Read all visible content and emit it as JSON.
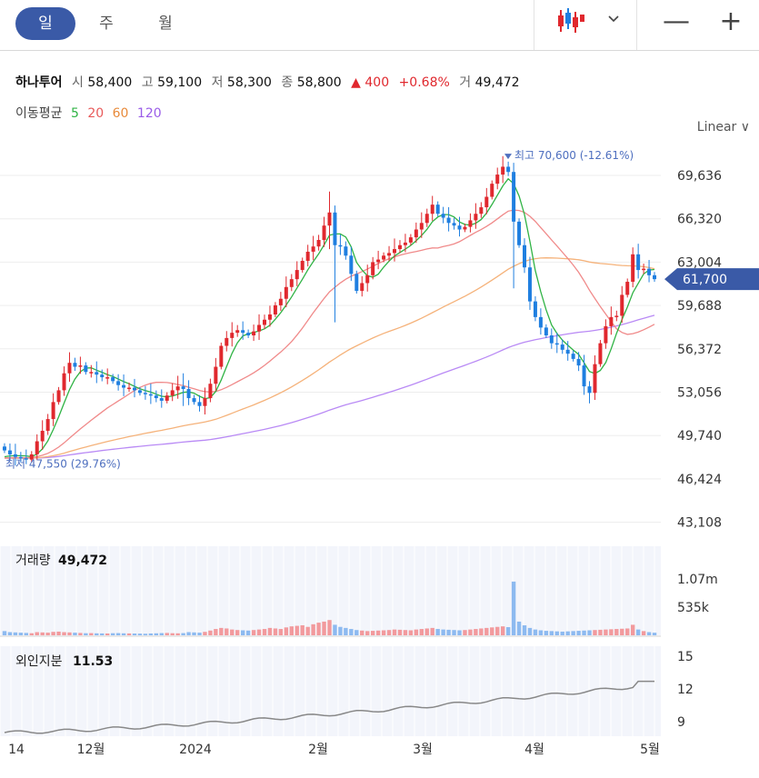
{
  "toolbar": {
    "periods": [
      "일",
      "주",
      "월"
    ],
    "active_period": "일",
    "chart_type_icon": "candlestick-icon",
    "dropdown_icon": "chevron-down-icon",
    "zoom_out": "—",
    "zoom_in": "+"
  },
  "quote": {
    "name": "하나투어",
    "open_label": "시",
    "open": "58,400",
    "high_label": "고",
    "high": "59,100",
    "low_label": "저",
    "low": "58,300",
    "close_label": "종",
    "close": "58,800",
    "change": "▲ 400",
    "change_pct": "+0.68%",
    "volume_label": "거",
    "volume": "49,472"
  },
  "ma_legend": {
    "label": "이동평균",
    "items": [
      {
        "name": "5",
        "color": "#2fb344"
      },
      {
        "name": "20",
        "color": "#f08a8a"
      },
      {
        "name": "60",
        "color": "#f2a25e"
      },
      {
        "name": "120",
        "color": "#a66cf0"
      }
    ]
  },
  "scale_mode": "Linear ∨",
  "chart_data": {
    "type": "candlestick",
    "colors": {
      "up": "#e0282e",
      "down": "#1f7fe0",
      "ma5": "#2fb344",
      "ma20": "#f08a8a",
      "ma60": "#f5b27a",
      "ma120": "#b98af5"
    },
    "price_axis": {
      "ticks": [
        69636,
        66320,
        63004,
        59688,
        56372,
        53056,
        49740,
        46424,
        43108
      ],
      "tick_labels": [
        "69,636",
        "66,320",
        "63,004",
        "59,688",
        "56,372",
        "53,056",
        "49,740",
        "46,424",
        "43,108"
      ]
    },
    "current_price": {
      "value": 61700,
      "label": "61,700"
    },
    "annotations": {
      "high": {
        "value": 70600,
        "text": "최고 70,600 (-12.61%)"
      },
      "low": {
        "value": 47550,
        "text": "최저 47,550 (29.76%)"
      }
    },
    "x_tick_labels": [
      "14",
      "12월",
      "2024",
      "2월",
      "3월",
      "4월",
      "5월"
    ],
    "close": [
      48600,
      48300,
      48100,
      48000,
      47900,
      48300,
      49300,
      50100,
      51000,
      52300,
      53200,
      54500,
      55300,
      55000,
      55100,
      54600,
      54600,
      54400,
      54200,
      54200,
      53900,
      53600,
      53400,
      53400,
      53200,
      53000,
      52900,
      52800,
      52600,
      52400,
      52800,
      53200,
      53500,
      53300,
      52600,
      52300,
      52000,
      52600,
      53700,
      55000,
      56600,
      57200,
      57600,
      57800,
      57600,
      57400,
      57700,
      58200,
      58600,
      59000,
      59700,
      60200,
      61100,
      61700,
      62400,
      63100,
      63800,
      64200,
      64700,
      65800,
      66800,
      64300,
      64200,
      63500,
      62100,
      60800,
      61400,
      62000,
      63000,
      63200,
      63500,
      63700,
      64000,
      64300,
      64500,
      64900,
      65500,
      66000,
      66700,
      67400,
      66700,
      66400,
      66000,
      65800,
      65500,
      65700,
      66200,
      66700,
      67200,
      68000,
      69000,
      69700,
      70300,
      69900,
      66100,
      64300,
      62600,
      60000,
      58800,
      58000,
      57400,
      56800,
      56700,
      56300,
      56000,
      55600,
      55100,
      53500,
      53000,
      55200,
      56800,
      58100,
      58800,
      58900,
      60500,
      61500,
      63600,
      62400,
      62500,
      62000,
      61700
    ],
    "volume_axis": {
      "ticks": [
        1070000,
        535000
      ],
      "tick_labels": [
        "1.07m",
        "535k"
      ]
    },
    "volume_header": {
      "label": "거래량",
      "value": "49,472"
    },
    "volume": [
      80000,
      60000,
      55000,
      50000,
      45000,
      40000,
      60000,
      55000,
      50000,
      65000,
      70000,
      60000,
      55000,
      50000,
      45000,
      40000,
      42000,
      38000,
      36000,
      35000,
      40000,
      42000,
      38000,
      36000,
      34000,
      32000,
      30000,
      35000,
      38000,
      42000,
      45000,
      40000,
      38000,
      42000,
      60000,
      55000,
      50000,
      65000,
      90000,
      120000,
      140000,
      130000,
      110000,
      100000,
      95000,
      90000,
      100000,
      110000,
      120000,
      140000,
      130000,
      120000,
      150000,
      170000,
      180000,
      190000,
      160000,
      210000,
      240000,
      260000,
      290000,
      200000,
      160000,
      140000,
      120000,
      100000,
      90000,
      80000,
      85000,
      90000,
      95000,
      100000,
      110000,
      105000,
      100000,
      95000,
      110000,
      120000,
      130000,
      140000,
      120000,
      110000,
      105000,
      100000,
      95000,
      100000,
      110000,
      120000,
      130000,
      140000,
      150000,
      160000,
      170000,
      155000,
      1020000,
      260000,
      190000,
      140000,
      110000,
      95000,
      85000,
      80000,
      75000,
      70000,
      75000,
      80000,
      85000,
      90000,
      95000,
      100000,
      105000,
      110000,
      115000,
      120000,
      125000,
      130000,
      200000,
      110000,
      80000,
      60000,
      49472
    ],
    "foreign_axis": {
      "ticks": [
        15,
        12,
        9
      ],
      "tick_labels": [
        "15",
        "12",
        "9"
      ]
    },
    "foreign_header": {
      "label": "외인지분",
      "value": "11.53"
    },
    "foreign_start": 8.0,
    "foreign_end": 12.4
  }
}
